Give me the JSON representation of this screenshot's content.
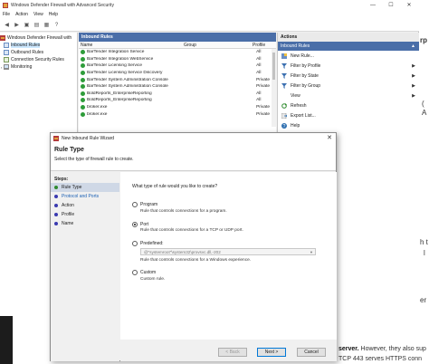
{
  "window": {
    "title": "Windows Defender Firewall with Advanced Security",
    "minimize": "—",
    "maximize": "☐",
    "close": "✕"
  },
  "menu": [
    "File",
    "Action",
    "View",
    "Help"
  ],
  "tree": {
    "root": "Windows Defender Firewall with",
    "items": [
      "Inbound Rules",
      "Outbound Rules",
      "Connection Security Rules",
      "Monitoring"
    ]
  },
  "center": {
    "header": "Inbound Rules",
    "columns": [
      "Name",
      "Group",
      "Profile"
    ],
    "rows": [
      {
        "name": "BarTender Integration Service",
        "group": "",
        "profile": "All"
      },
      {
        "name": "BarTender Integration WebService",
        "group": "",
        "profile": "All"
      },
      {
        "name": "BarTender Licensing Service",
        "group": "",
        "profile": "All"
      },
      {
        "name": "BarTender Licensing Service Discovery",
        "group": "",
        "profile": "All"
      },
      {
        "name": "BarTender System Administration Console",
        "group": "",
        "profile": "Private"
      },
      {
        "name": "BarTender System Administration Console",
        "group": "",
        "profile": "Private"
      },
      {
        "name": "BoldReports_EnterpriseReporting",
        "group": "",
        "profile": "All"
      },
      {
        "name": "BoldReports_EnterpriseReporting",
        "group": "",
        "profile": "All"
      },
      {
        "name": "broker.exe",
        "group": "",
        "profile": "Private"
      },
      {
        "name": "broker.exe",
        "group": "",
        "profile": "Private"
      }
    ]
  },
  "actions": {
    "header": "Actions",
    "section": "Inbound Rules",
    "items": [
      {
        "label": "New Rule...",
        "icon": "new-rule-icon",
        "submenu": false
      },
      {
        "label": "Filter by Profile",
        "icon": "filter-icon",
        "submenu": true
      },
      {
        "label": "Filter by State",
        "icon": "filter-icon",
        "submenu": true
      },
      {
        "label": "Filter by Group",
        "icon": "filter-icon",
        "submenu": true
      },
      {
        "label": "View",
        "icon": "",
        "submenu": true
      },
      {
        "label": "Refresh",
        "icon": "refresh-icon",
        "submenu": false
      },
      {
        "label": "Export List...",
        "icon": "export-icon",
        "submenu": false
      },
      {
        "label": "Help",
        "icon": "help-icon",
        "submenu": false
      }
    ]
  },
  "wizard": {
    "title": "New Inbound Rule Wizard",
    "heading": "Rule Type",
    "subheading": "Select the type of firewall rule to create.",
    "steps_label": "Steps:",
    "steps": [
      "Rule Type",
      "Protocol and Ports",
      "Action",
      "Profile",
      "Name"
    ],
    "question": "What type of rule would you like to create?",
    "options": [
      {
        "label": "Program",
        "desc": "Rule that controls connections for a program.",
        "selected": false
      },
      {
        "label": "Port",
        "desc": "Rule that controls connections for a TCP or UDP port.",
        "selected": true
      },
      {
        "label": "Predefined:",
        "desc": "Rule that controls connections for a Windows experience.",
        "selected": false
      },
      {
        "label": "Custom",
        "desc": "Custom rule.",
        "selected": false
      }
    ],
    "predefined_value": "@\"systemroot\"\\system32\\provsvc.dll,-202",
    "back": "< Back",
    "next": "Next >",
    "cancel": "Cancel"
  },
  "background": {
    "frag1": "rp",
    "frag2": "(",
    "frag3": "A",
    "frag4": "h t",
    "frag5": "l",
    "frag6": "er",
    "bottom1_bold": "server.",
    "bottom1": " However, they also sup",
    "bottom2": "TCP 443 serves HTTPS conn"
  },
  "colors": {
    "selection_blue": "#4a6ea8",
    "rule_enabled_green": "#2e9c3a"
  }
}
